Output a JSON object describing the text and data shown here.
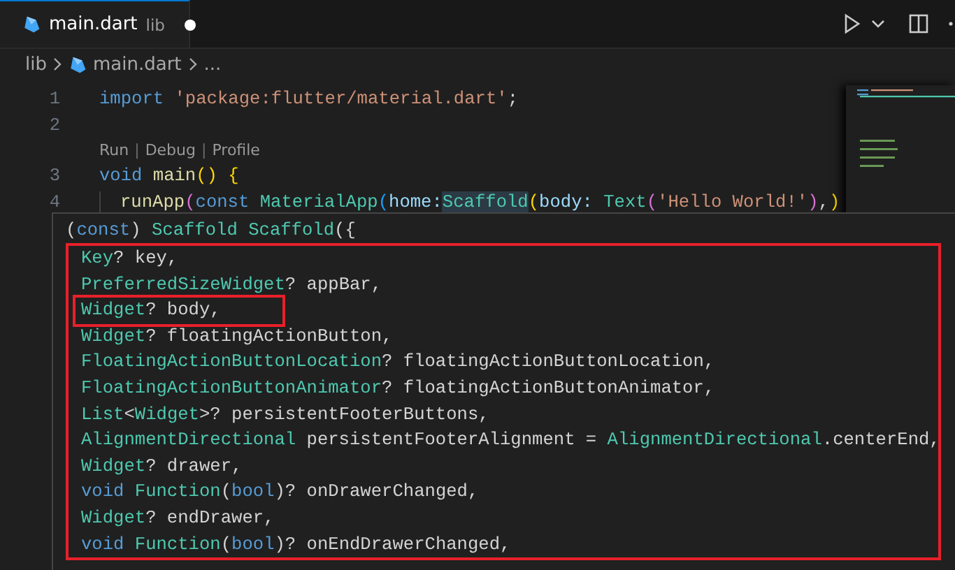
{
  "tab": {
    "title": "main.dart",
    "folder": "lib",
    "modified": true,
    "selected": true
  },
  "breadcrumbs": [
    "lib",
    "main.dart",
    "..."
  ],
  "code_lines": [
    {
      "number": "1",
      "tokens": [
        {
          "kind": "kw",
          "text": "import"
        },
        {
          "kind": "str",
          "text": " 'package:flutter/material.dart'"
        },
        {
          "kind": "plain",
          "text": ";"
        }
      ]
    },
    {
      "number": "2"
    },
    {
      "codelens": [
        {
          "kind": "link",
          "text": "Run"
        },
        {
          "kind": "sep",
          "text": "|"
        },
        {
          "kind": "link",
          "text": "Debug"
        },
        {
          "kind": "sep",
          "text": "|"
        },
        {
          "kind": "link",
          "text": "Profile"
        }
      ]
    },
    {
      "number": "3",
      "tokens": [
        {
          "kind": "kw",
          "text": "void"
        },
        {
          "kind": "fn",
          "text": " main"
        },
        {
          "kind": "b1",
          "text": "() {"
        }
      ]
    },
    {
      "number": "4",
      "indent": true,
      "tokens": [
        {
          "kind": "fn",
          "text": "runApp"
        },
        {
          "kind": "b2",
          "text": "("
        },
        {
          "kind": "kw",
          "text": "const"
        },
        {
          "kind": "type",
          "text": " MaterialApp"
        },
        {
          "kind": "b3",
          "text": "("
        },
        {
          "kind": "param",
          "text": "home:"
        },
        {
          "kind": "type",
          "text": "Scaffold",
          "highlighted": true
        },
        {
          "kind": "b1",
          "text": "("
        },
        {
          "kind": "param",
          "text": "body:"
        },
        {
          "kind": "type",
          "text": " Text"
        },
        {
          "kind": "b2",
          "text": "("
        },
        {
          "kind": "str",
          "text": "'Hello World!'"
        },
        {
          "kind": "b2",
          "text": ")"
        },
        {
          "kind": "plain",
          "text": ","
        },
        {
          "kind": "b1",
          "text": ")"
        }
      ]
    }
  ],
  "hover": {
    "signature": [
      {
        "kind": "plain",
        "text": "("
      },
      {
        "kind": "kw",
        "text": "const"
      },
      {
        "kind": "plain",
        "text": ")"
      },
      {
        "kind": "type",
        "text": " Scaffold"
      },
      {
        "kind": "type",
        "text": " Scaffold"
      },
      {
        "kind": "plain",
        "text": "({"
      }
    ],
    "params": [
      {
        "highlighted": false,
        "tokens": [
          {
            "kind": "type",
            "text": "Key"
          },
          {
            "kind": "plain",
            "text": "? key,"
          }
        ]
      },
      {
        "highlighted": false,
        "tokens": [
          {
            "kind": "type",
            "text": "PreferredSizeWidget"
          },
          {
            "kind": "plain",
            "text": "? appBar,"
          }
        ]
      },
      {
        "highlighted": true,
        "tokens": [
          {
            "kind": "type",
            "text": "Widget"
          },
          {
            "kind": "plain",
            "text": "? body,"
          }
        ]
      },
      {
        "highlighted": false,
        "tokens": [
          {
            "kind": "type",
            "text": "Widget"
          },
          {
            "kind": "plain",
            "text": "? floatingActionButton,"
          }
        ]
      },
      {
        "highlighted": false,
        "tokens": [
          {
            "kind": "type",
            "text": "FloatingActionButtonLocation"
          },
          {
            "kind": "plain",
            "text": "? floatingActionButtonLocation,"
          }
        ]
      },
      {
        "highlighted": false,
        "tokens": [
          {
            "kind": "type",
            "text": "FloatingActionButtonAnimator"
          },
          {
            "kind": "plain",
            "text": "? floatingActionButtonAnimator,"
          }
        ]
      },
      {
        "highlighted": false,
        "tokens": [
          {
            "kind": "type",
            "text": "List"
          },
          {
            "kind": "plain",
            "text": "<"
          },
          {
            "kind": "type",
            "text": "Widget"
          },
          {
            "kind": "plain",
            "text": ">? persistentFooterButtons,"
          }
        ]
      },
      {
        "highlighted": false,
        "tokens": [
          {
            "kind": "type",
            "text": "AlignmentDirectional"
          },
          {
            "kind": "plain",
            "text": " persistentFooterAlignment = "
          },
          {
            "kind": "type",
            "text": "AlignmentDirectional"
          },
          {
            "kind": "plain",
            "text": ".centerEnd,"
          }
        ]
      },
      {
        "highlighted": false,
        "tokens": [
          {
            "kind": "type",
            "text": "Widget"
          },
          {
            "kind": "plain",
            "text": "? drawer,"
          }
        ]
      },
      {
        "highlighted": false,
        "tokens": [
          {
            "kind": "kw",
            "text": "void"
          },
          {
            "kind": "type",
            "text": " Function"
          },
          {
            "kind": "plain",
            "text": "("
          },
          {
            "kind": "kw",
            "text": "bool"
          },
          {
            "kind": "plain",
            "text": ")? onDrawerChanged,"
          }
        ]
      },
      {
        "highlighted": false,
        "tokens": [
          {
            "kind": "type",
            "text": "Widget"
          },
          {
            "kind": "plain",
            "text": "? endDrawer,"
          }
        ]
      },
      {
        "highlighted": false,
        "tokens": [
          {
            "kind": "kw",
            "text": "void"
          },
          {
            "kind": "type",
            "text": " Function"
          },
          {
            "kind": "plain",
            "text": "("
          },
          {
            "kind": "kw",
            "text": "bool"
          },
          {
            "kind": "plain",
            "text": ")? onEndDrawerChanged,"
          }
        ]
      }
    ]
  }
}
